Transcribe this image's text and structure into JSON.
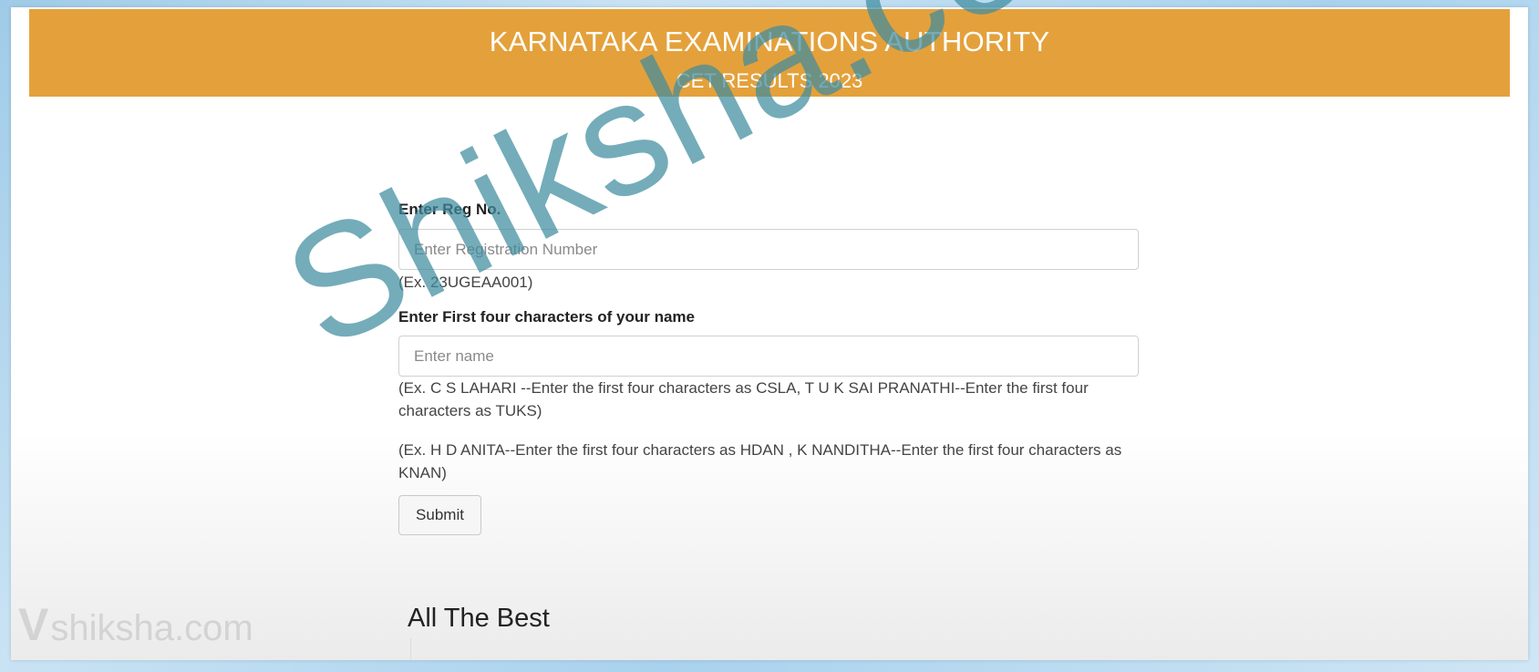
{
  "header": {
    "title": "KARNATAKA EXAMINATIONS AUTHORITY",
    "subtitle": "CET RESULTS 2023",
    "background_color": "#e4a13b"
  },
  "form": {
    "reg_label": "Enter Reg No.",
    "reg_placeholder": "Enter Registration Number",
    "reg_value": "",
    "reg_help": "(Ex. 23UGEAA001)",
    "name_label": "Enter First four characters of your name",
    "name_placeholder": "Enter name",
    "name_value": "",
    "name_help_1": "(Ex. C S LAHARI --Enter the first four characters as CSLA, T U K SAI PRANATHI--Enter the first four characters as TUKS)",
    "name_help_2": "(Ex. H D ANITA--Enter the first four characters as HDAN , K NANDITHA--Enter the first four characters as KNAN)",
    "submit_label": "Submit"
  },
  "footer_message": "All The Best",
  "watermark": {
    "main_text": "Shiksha.com",
    "logo_text": "shiksha.com",
    "logo_mark": "V"
  }
}
